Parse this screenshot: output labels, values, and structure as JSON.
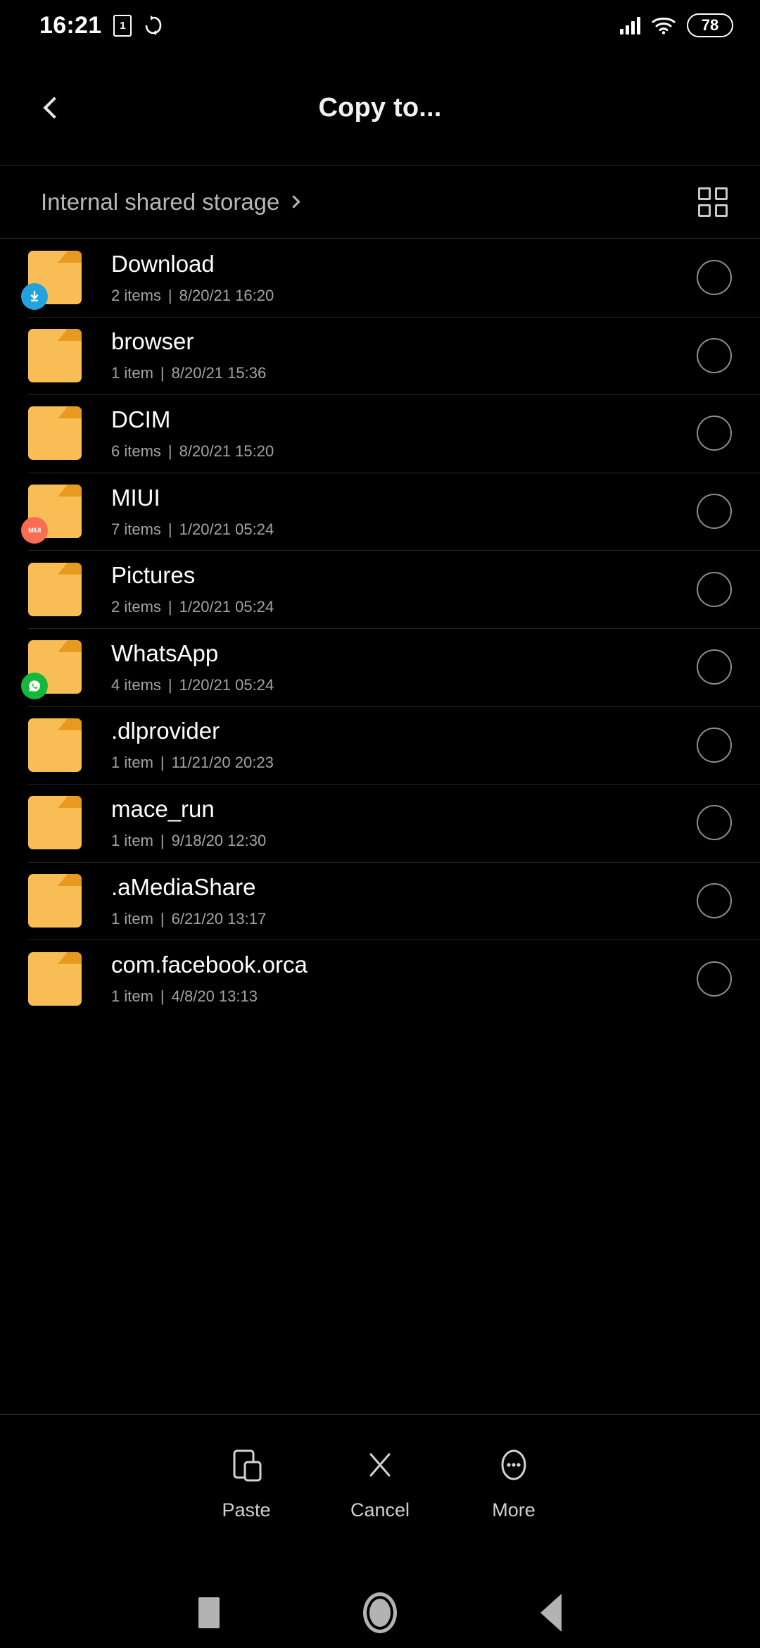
{
  "status_bar": {
    "time": "16:21",
    "sim_badge": "1",
    "sync_icon": "sync-icon",
    "signal_icon": "cellular-signal-icon",
    "wifi_icon": "wifi-icon",
    "battery_level": "78"
  },
  "app_bar": {
    "title": "Copy to...",
    "back_icon": "back-chevron-icon"
  },
  "breadcrumb": {
    "path_label": "Internal shared storage",
    "chevron_icon": "chevron-right-icon",
    "view_toggle_icon": "grid-view-icon"
  },
  "files": [
    {
      "name": "Download",
      "count": "2 items",
      "separator": "|",
      "date": "8/20/21 16:20",
      "badge": "download-badge",
      "badge_text": "",
      "selected": false
    },
    {
      "name": "browser",
      "count": "1 item",
      "separator": "|",
      "date": "8/20/21 15:36",
      "badge": "",
      "badge_text": "",
      "selected": false
    },
    {
      "name": "DCIM",
      "count": "6 items",
      "separator": "|",
      "date": "8/20/21 15:20",
      "badge": "",
      "badge_text": "",
      "selected": false
    },
    {
      "name": "MIUI",
      "count": "7 items",
      "separator": "|",
      "date": "1/20/21 05:24",
      "badge": "miui-badge",
      "badge_text": "MIUI",
      "selected": false
    },
    {
      "name": "Pictures",
      "count": "2 items",
      "separator": "|",
      "date": "1/20/21 05:24",
      "badge": "",
      "badge_text": "",
      "selected": false
    },
    {
      "name": "WhatsApp",
      "count": "4 items",
      "separator": "|",
      "date": "1/20/21 05:24",
      "badge": "whatsapp-badge",
      "badge_text": "",
      "selected": false
    },
    {
      "name": ".dlprovider",
      "count": "1 item",
      "separator": "|",
      "date": "11/21/20 20:23",
      "badge": "",
      "badge_text": "",
      "selected": false
    },
    {
      "name": "mace_run",
      "count": "1 item",
      "separator": "|",
      "date": "9/18/20 12:30",
      "badge": "",
      "badge_text": "",
      "selected": false
    },
    {
      "name": ".aMediaShare",
      "count": "1 item",
      "separator": "|",
      "date": "6/21/20 13:17",
      "badge": "",
      "badge_text": "",
      "selected": false
    },
    {
      "name": "com.facebook.orca",
      "count": "1 item",
      "separator": "|",
      "date": "4/8/20 13:13",
      "badge": "",
      "badge_text": "",
      "selected": false
    }
  ],
  "toolbar": [
    {
      "label": "Paste",
      "icon": "paste-icon"
    },
    {
      "label": "Cancel",
      "icon": "close-x-icon"
    },
    {
      "label": "More",
      "icon": "more-dots-icon"
    }
  ],
  "nav_bar": [
    {
      "icon": "recents-square-icon"
    },
    {
      "icon": "home-circle-icon"
    },
    {
      "icon": "back-triangle-icon"
    }
  ],
  "colors": {
    "background": "#000000",
    "folder": "#F9BD55",
    "folder_tab": "#E8991F",
    "download_badge": "#22A3DD",
    "miui_badge": "#FA6D53",
    "whatsapp_badge": "#15B83C",
    "divider": "#262626",
    "primary_text": "#FFFFFF",
    "secondary_text": "#A4A4A4"
  }
}
